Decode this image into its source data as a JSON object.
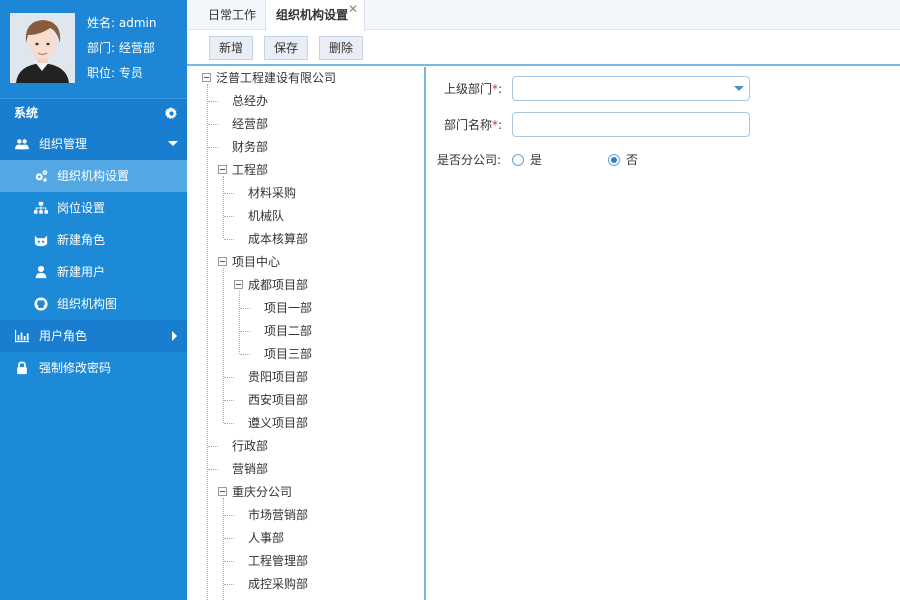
{
  "profile": {
    "name_line": "姓名: admin",
    "dept_line": "部门: 经营部",
    "title_line": "职位: 专员"
  },
  "sidebar": {
    "section_title": "系统",
    "items": [
      {
        "label": "组织管理",
        "icon": "users-icon",
        "type": "group",
        "expanded": true
      },
      {
        "label": "组织机构设置",
        "icon": "gears-icon",
        "type": "sub",
        "active": true
      },
      {
        "label": "岗位设置",
        "icon": "sitemap-icon",
        "type": "sub"
      },
      {
        "label": "新建角色",
        "icon": "role-icon",
        "type": "sub"
      },
      {
        "label": "新建用户",
        "icon": "user-icon",
        "type": "sub"
      },
      {
        "label": "组织机构图",
        "icon": "github-icon",
        "type": "sub"
      },
      {
        "label": "用户角色",
        "icon": "bar-chart-icon",
        "type": "group",
        "expanded": false
      },
      {
        "label": "强制修改密码",
        "icon": "lock-icon",
        "type": "group"
      }
    ]
  },
  "tabs": [
    {
      "label": "日常工作"
    },
    {
      "label": "组织机构设置",
      "active": true,
      "close": "✕"
    }
  ],
  "toolbar": {
    "add": "新增",
    "save": "保存",
    "delete": "删除"
  },
  "tree": {
    "root": "泛普工程建设有限公司",
    "n_zjb": "总经办",
    "n_jyb": "经营部",
    "n_cwb": "财务部",
    "n_gcb": "工程部",
    "n_clcg": "材料采购",
    "n_jxd": "机械队",
    "n_cbhs": "成本核算部",
    "n_xmzx": "项目中心",
    "n_cdxm": "成都项目部",
    "n_xm1": "项目一部",
    "n_xm2": "项目二部",
    "n_xm3": "项目三部",
    "n_gyxm": "贵阳项目部",
    "n_xaxm": "西安项目部",
    "n_zyxm": "遵义项目部",
    "n_xzb": "行政部",
    "n_yxb": "营销部",
    "n_cqfgs": "重庆分公司",
    "n_scyx": "市场营销部",
    "n_rsb": "人事部",
    "n_gcgl": "工程管理部",
    "n_ckcg": "成控采购部"
  },
  "form": {
    "parent_label": "上级部门",
    "parent_value": "",
    "name_label": "部门名称",
    "name_value": "",
    "required_mark": "*",
    "branch_label": "是否分公司:",
    "colon": ":",
    "yes": "是",
    "no": "否",
    "branch_selected": "否"
  },
  "colors": {
    "sidebar_bg": "#1d8ad8",
    "active_item": "#53a8e4",
    "accent": "#7ab6e2"
  }
}
